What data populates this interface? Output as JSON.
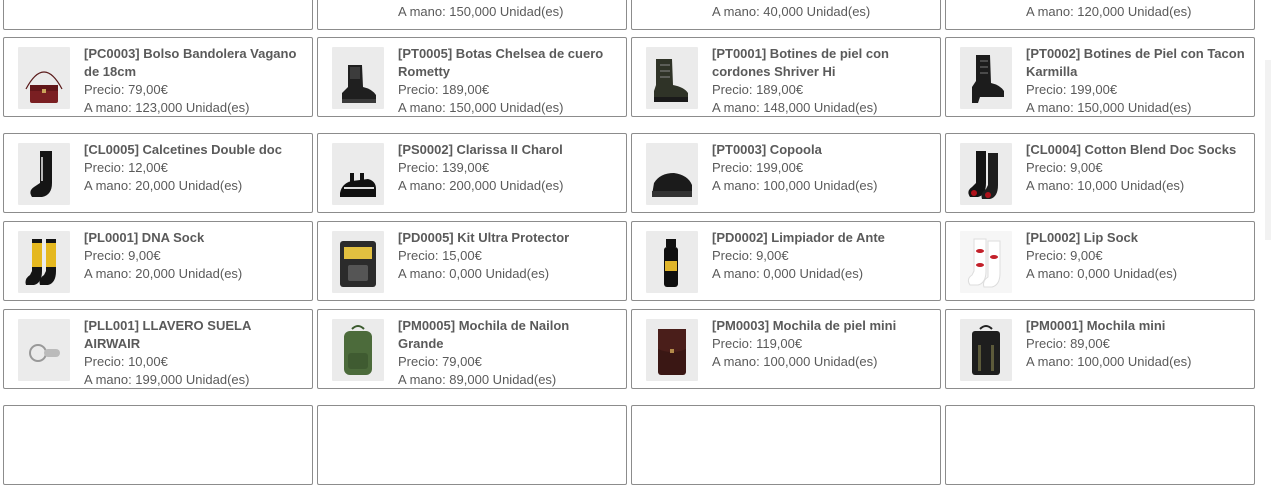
{
  "partial_top": [
    {
      "stock": "A mano: 150,000 Unidad(es)"
    },
    {
      "stock": "A mano: 40,000 Unidad(es)"
    },
    {
      "stock": "A mano: 120,000 Unidad(es)"
    }
  ],
  "rows": [
    [
      {
        "name": "[PC0003] Bolso Bandolera Vagano de 18cm",
        "price": "Precio: 79,00€",
        "stock": "A mano: 123,000 Unidad(es)",
        "icon": "crossbody-bag-icon"
      },
      {
        "name": "[PT0005] Botas Chelsea de cuero Rometty",
        "price": "Precio: 189,00€",
        "stock": "A mano: 150,000 Unidad(es)",
        "icon": "chelsea-boot-icon"
      },
      {
        "name": "[PT0001] Botines de piel con cordones Shriver Hi",
        "price": "Precio: 189,00€",
        "stock": "A mano: 148,000 Unidad(es)",
        "icon": "lace-boot-icon"
      },
      {
        "name": "[PT0002] Botines de Piel con Tacon Karmilla",
        "price": "Precio: 199,00€",
        "stock": "A mano: 150,000 Unidad(es)",
        "icon": "heeled-boot-icon"
      }
    ],
    [
      {
        "name": "[CL0005] Calcetines Double doc",
        "price": "Precio: 12,00€",
        "stock": "A mano: 20,000 Unidad(es)",
        "icon": "black-sock-icon"
      },
      {
        "name": "[PS0002] Clarissa II Charol",
        "price": "Precio: 139,00€",
        "stock": "A mano: 200,000 Unidad(es)",
        "icon": "sandal-icon"
      },
      {
        "name": "[PT0003] Copoola",
        "price": "Precio: 199,00€",
        "stock": "A mano: 100,000 Unidad(es)",
        "icon": "platform-shoe-icon"
      },
      {
        "name": "[CL0004] Cotton Blend Doc Socks",
        "price": "Precio: 9,00€",
        "stock": "A mano: 10,000 Unidad(es)",
        "icon": "red-trim-sock-icon"
      }
    ],
    [
      {
        "name": "[PL0001] DNA Sock",
        "price": "Precio: 9,00€",
        "stock": "A mano: 20,000 Unidad(es)",
        "icon": "yellow-sock-icon"
      },
      {
        "name": "[PD0005] Kit Ultra Protector",
        "price": "Precio: 15,00€",
        "stock": "A mano: 0,000 Unidad(es)",
        "icon": "care-kit-icon"
      },
      {
        "name": "[PD0002] Limpiador de Ante",
        "price": "Precio: 9,00€",
        "stock": "A mano: 0,000 Unidad(es)",
        "icon": "spray-bottle-icon"
      },
      {
        "name": "[PL0002] Lip Sock",
        "price": "Precio: 9,00€",
        "stock": "A mano: 0,000 Unidad(es)",
        "icon": "lip-sock-icon"
      }
    ],
    [
      {
        "name": "[PLL001] LLAVERO SUELA AIRWAIR",
        "price": "Precio: 10,00€",
        "stock": "A mano: 199,000 Unidad(es)",
        "icon": "keychain-icon"
      },
      {
        "name": "[PM0005] Mochila de Nailon Grande",
        "price": "Precio: 79,00€",
        "stock": "A mano: 89,000 Unidad(es)",
        "icon": "green-backpack-icon"
      },
      {
        "name": "[PM0003] Mochila de piel mini",
        "price": "Precio: 119,00€",
        "stock": "A mano: 100,000 Unidad(es)",
        "icon": "leather-backpack-icon"
      },
      {
        "name": "[PM0001] Mochila mini",
        "price": "Precio: 89,00€",
        "stock": "A mano: 100,000 Unidad(es)",
        "icon": "mini-backpack-icon"
      }
    ]
  ]
}
